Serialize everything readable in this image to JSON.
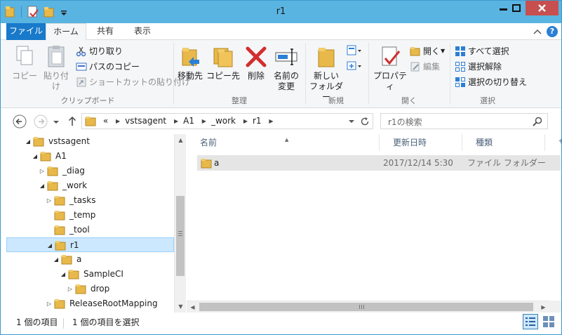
{
  "window": {
    "title": "r1",
    "controls": {
      "minimize": "—",
      "maximize": "□",
      "close": "✕"
    }
  },
  "ribbon_tabs": [
    "ファイル",
    "ホーム",
    "共有",
    "表示"
  ],
  "help_label": "?",
  "ribbon": {
    "clipboard": {
      "label": "クリップボード",
      "copy": "コピー",
      "paste": "貼り付け",
      "cut": "切り取り",
      "copy_path": "パスのコピー",
      "paste_shortcut": "ショートカットの貼り付け"
    },
    "organize": {
      "label": "整理",
      "move_to": "移動先",
      "copy_to": "コピー先",
      "delete": "削除",
      "rename_line1": "名前の",
      "rename_line2": "変更"
    },
    "new": {
      "label": "新規",
      "new_folder_line1": "新しい",
      "new_folder_line2": "フォルダー"
    },
    "open": {
      "label": "開く",
      "properties": "プロパティ",
      "open": "開く",
      "edit": "編集"
    },
    "select": {
      "label": "選択",
      "select_all": "すべて選択",
      "select_none": "選択解除",
      "invert": "選択の切り替え"
    }
  },
  "address": {
    "overflow": "«",
    "crumbs": [
      "vstsagent",
      "A1",
      "_work",
      "r1"
    ]
  },
  "search": {
    "placeholder": "r1の検索"
  },
  "tree": [
    {
      "label": "vstsagent",
      "level": 0,
      "twisty": "◢"
    },
    {
      "label": "A1",
      "level": 1,
      "twisty": "◢"
    },
    {
      "label": "_diag",
      "level": 2,
      "twisty": "▷"
    },
    {
      "label": "_work",
      "level": 2,
      "twisty": "◢"
    },
    {
      "label": "_tasks",
      "level": 3,
      "twisty": "▷"
    },
    {
      "label": "_temp",
      "level": 3,
      "twisty": ""
    },
    {
      "label": "_tool",
      "level": 3,
      "twisty": ""
    },
    {
      "label": "r1",
      "level": 3,
      "twisty": "◢",
      "selected": true
    },
    {
      "label": "a",
      "level": 4,
      "twisty": "◢"
    },
    {
      "label": "SampleCI",
      "level": 5,
      "twisty": "◢"
    },
    {
      "label": "drop",
      "level": 6,
      "twisty": "▷"
    },
    {
      "label": "ReleaseRootMapping",
      "level": 3,
      "twisty": "▷"
    }
  ],
  "columns": {
    "name": "名前",
    "modified": "更新日時",
    "type": "種類",
    "size": "サ"
  },
  "files": [
    {
      "name": "a",
      "modified": "2017/12/14 5:30",
      "type": "ファイル フォルダー"
    }
  ],
  "status": {
    "item_count": "1 個の項目",
    "selected": "1 個の項目を選択"
  },
  "colors": {
    "titlebar": "#5ab4e1",
    "file_tab": "#1979ca",
    "selection": "#cce8ff",
    "folder": "#e8b94a"
  }
}
